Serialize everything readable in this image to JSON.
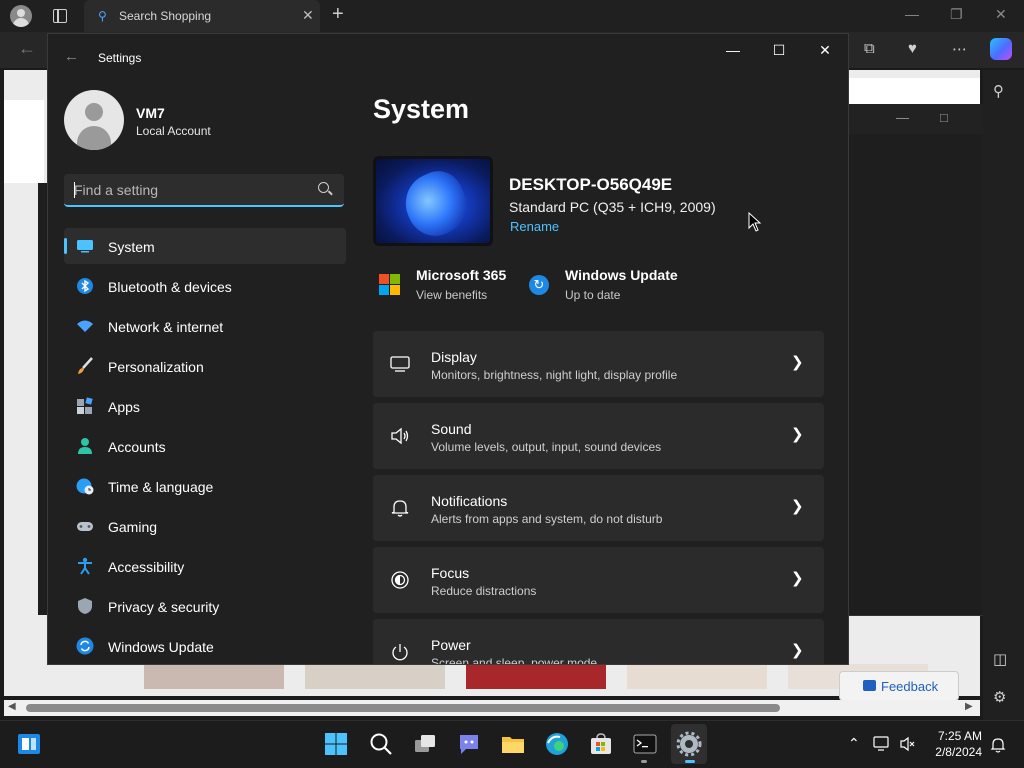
{
  "browser": {
    "tab_title": "Search Shopping",
    "feedback_label": "Feedback"
  },
  "settings": {
    "window_title": "Settings",
    "account": {
      "name": "VM7",
      "type": "Local Account"
    },
    "search": {
      "placeholder": "Find a setting"
    },
    "nav": [
      {
        "label": "System",
        "icon": "system-display-icon",
        "selected": true
      },
      {
        "label": "Bluetooth & devices",
        "icon": "bluetooth-icon"
      },
      {
        "label": "Network & internet",
        "icon": "wifi-icon"
      },
      {
        "label": "Personalization",
        "icon": "paintbrush-icon"
      },
      {
        "label": "Apps",
        "icon": "apps-icon"
      },
      {
        "label": "Accounts",
        "icon": "person-icon"
      },
      {
        "label": "Time & language",
        "icon": "globe-clock-icon"
      },
      {
        "label": "Gaming",
        "icon": "gamepad-icon"
      },
      {
        "label": "Accessibility",
        "icon": "accessibility-icon"
      },
      {
        "label": "Privacy & security",
        "icon": "shield-icon"
      },
      {
        "label": "Windows Update",
        "icon": "update-icon"
      }
    ],
    "page_title": "System",
    "device": {
      "name": "DESKTOP-O56Q49E",
      "model": "Standard PC (Q35 + ICH9, 2009)",
      "rename_label": "Rename"
    },
    "quick": [
      {
        "title": "Microsoft 365",
        "subtitle": "View benefits",
        "icon": "microsoft-logo-icon"
      },
      {
        "title": "Windows Update",
        "subtitle": "Up to date",
        "icon": "update-icon"
      }
    ],
    "cards": [
      {
        "title": "Display",
        "subtitle": "Monitors, brightness, night light, display profile",
        "icon": "monitor-icon"
      },
      {
        "title": "Sound",
        "subtitle": "Volume levels, output, input, sound devices",
        "icon": "speaker-icon"
      },
      {
        "title": "Notifications",
        "subtitle": "Alerts from apps and system, do not disturb",
        "icon": "bell-icon"
      },
      {
        "title": "Focus",
        "subtitle": "Reduce distractions",
        "icon": "focus-icon"
      },
      {
        "title": "Power",
        "subtitle": "Screen and sleep, power mode",
        "icon": "power-icon"
      }
    ]
  },
  "taskbar": {
    "time": "7:25 AM",
    "date": "2/8/2024"
  },
  "colors": {
    "accent": "#4cc2ff",
    "window_bg": "#202020",
    "card_bg": "#2b2b2b"
  }
}
